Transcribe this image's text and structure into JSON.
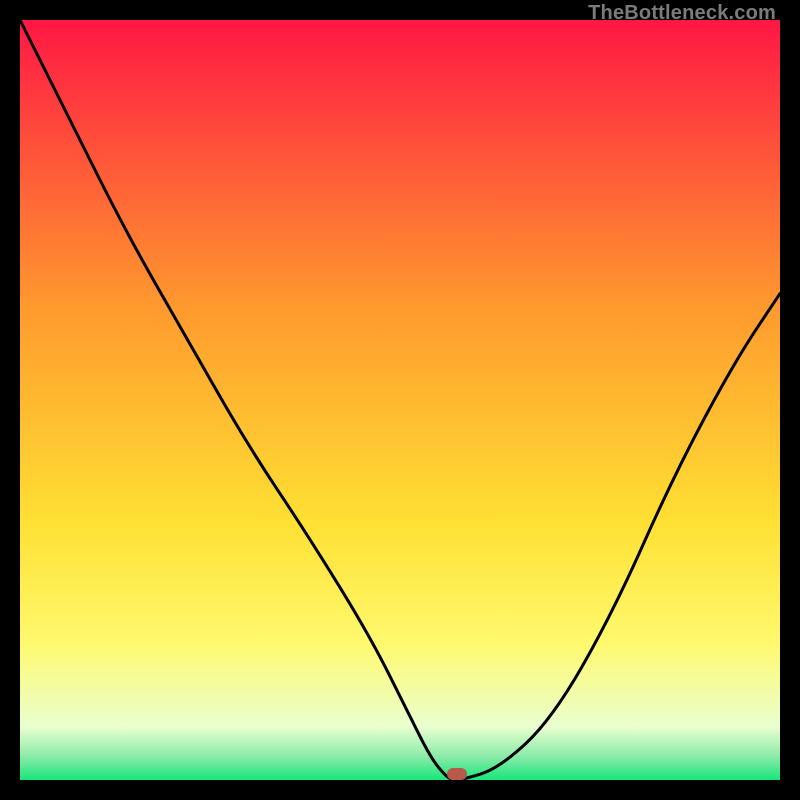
{
  "watermark": {
    "text": "TheBottleneck.com"
  },
  "colors": {
    "bg": "#000000",
    "top": "#ff1744",
    "mid1": "#ff9130",
    "mid2": "#ffd83b",
    "mid3": "#fff76a",
    "mid4": "#f6ffb8",
    "bottom": "#17e67a",
    "curve": "#000000",
    "marker": "#b85a4a"
  },
  "chart_data": {
    "type": "line",
    "title": "",
    "xlabel": "",
    "ylabel": "",
    "xlim": [
      0,
      100
    ],
    "ylim": [
      0,
      100
    ],
    "grid": false,
    "series": [
      {
        "name": "bottleneck-curve",
        "x": [
          0,
          6,
          14,
          22,
          30,
          38,
          46,
          51,
          54,
          56,
          57,
          58,
          63,
          70,
          78,
          86,
          94,
          100
        ],
        "y": [
          100,
          88,
          72,
          58,
          44,
          32,
          19,
          9,
          3,
          0.5,
          0,
          0,
          1.5,
          8,
          22,
          40,
          55,
          64
        ]
      }
    ],
    "annotations": [
      {
        "name": "marker",
        "x": 57.5,
        "y": 0.8
      }
    ],
    "gradient_stops": [
      {
        "pct": 0,
        "color": "#ff1744"
      },
      {
        "pct": 38,
        "color": "#ff9a2e"
      },
      {
        "pct": 66,
        "color": "#ffe033"
      },
      {
        "pct": 82,
        "color": "#fff96e"
      },
      {
        "pct": 93,
        "color": "#e9ffcf"
      },
      {
        "pct": 97,
        "color": "#88eaa8"
      },
      {
        "pct": 100,
        "color": "#17e67a"
      }
    ]
  }
}
